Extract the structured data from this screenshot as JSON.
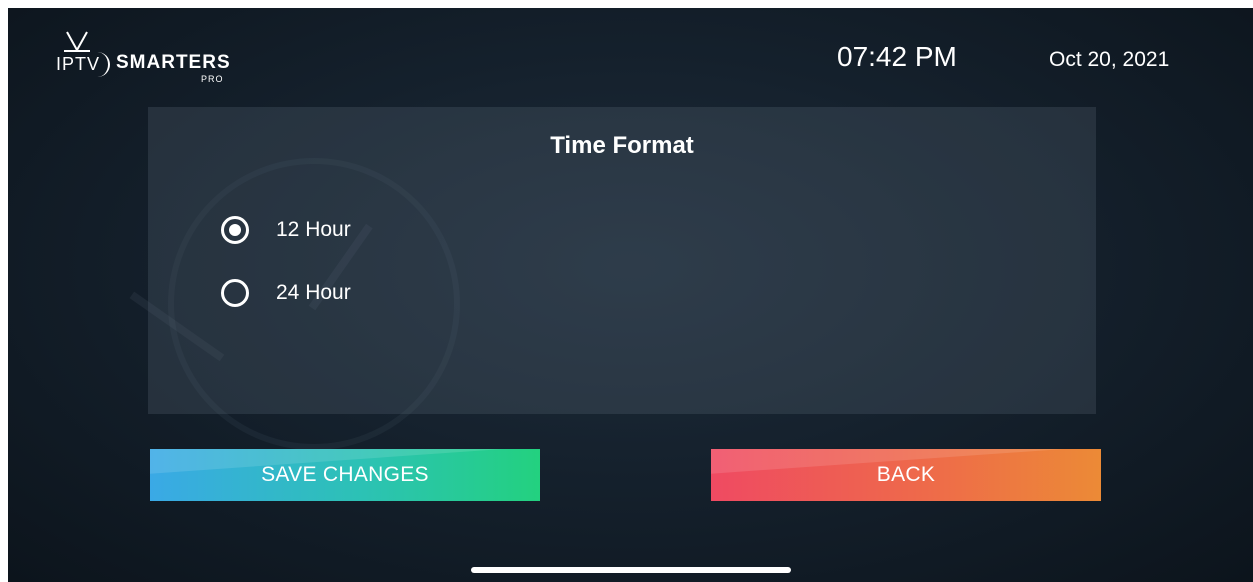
{
  "header": {
    "logo_iptv": "IPTV",
    "logo_smarters": "SMARTERS",
    "logo_pro": "PRO",
    "time": "07:42 PM",
    "date": "Oct 20, 2021"
  },
  "dialog": {
    "title": "Time Format",
    "options": [
      {
        "label": "12 Hour",
        "selected": true
      },
      {
        "label": "24 Hour",
        "selected": false
      }
    ]
  },
  "buttons": {
    "save_label": "SAVE CHANGES",
    "back_label": "BACK"
  },
  "colors": {
    "save_gradient_start": "#3aa9e6",
    "save_gradient_end": "#23d17f",
    "back_gradient_start": "#ef4a62",
    "back_gradient_end": "#ec8a36",
    "background": "#15212d"
  },
  "icons": {
    "radio_selected": "radio-checked-icon",
    "radio_unselected": "radio-unchecked-icon"
  }
}
